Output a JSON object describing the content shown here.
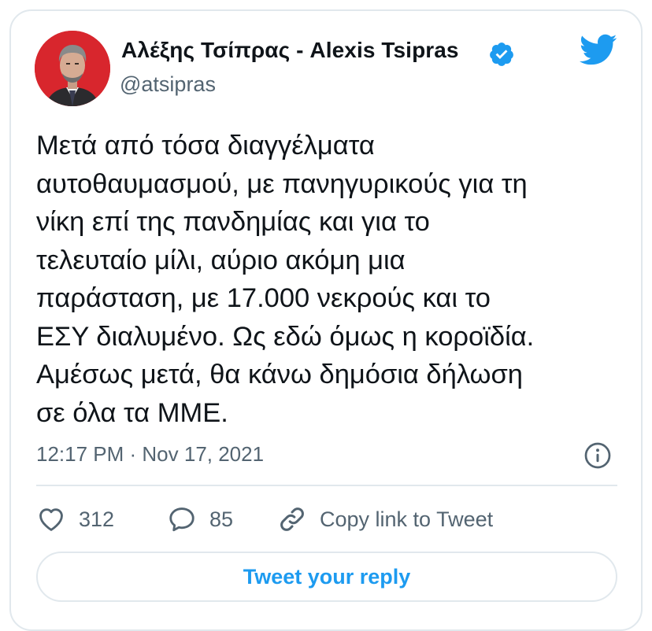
{
  "author": {
    "display_name": "Αλέξης Τσίπρας - Alexis Tsipras",
    "handle": "@atsipras",
    "verified": true
  },
  "tweet": {
    "lines": [
      "Μετά από τόσα διαγγέλματα",
      "αυτοθαυμασμού, με πανηγυρικούς για τη",
      "νίκη επί της πανδημίας και για το",
      "τελευταίο μίλι, αύριο ακόμη μια",
      "παράσταση, με 17.000 νεκρούς και το",
      "ΕΣΥ διαλυμένο. Ως εδώ όμως η κοροϊδία.",
      "Αμέσως μετά, θα κάνω δημόσια δήλωση",
      "σε όλα τα ΜΜΕ."
    ],
    "timestamp": "12:17 PM · Nov 17, 2021"
  },
  "actions": {
    "likes": "312",
    "replies": "85",
    "copy_link": "Copy link to Tweet"
  },
  "reply_button": "Tweet your reply",
  "icons": {
    "brand": "twitter-bird-icon",
    "verified": "verified-badge-icon",
    "info": "info-icon",
    "like": "heart-icon",
    "reply": "speech-bubble-icon",
    "link": "link-icon"
  },
  "colors": {
    "accent": "#1d9bf0",
    "text": "#0f1419",
    "secondary": "#536471",
    "border": "#e1e8ed",
    "avatar_bg": "#d8262d"
  }
}
